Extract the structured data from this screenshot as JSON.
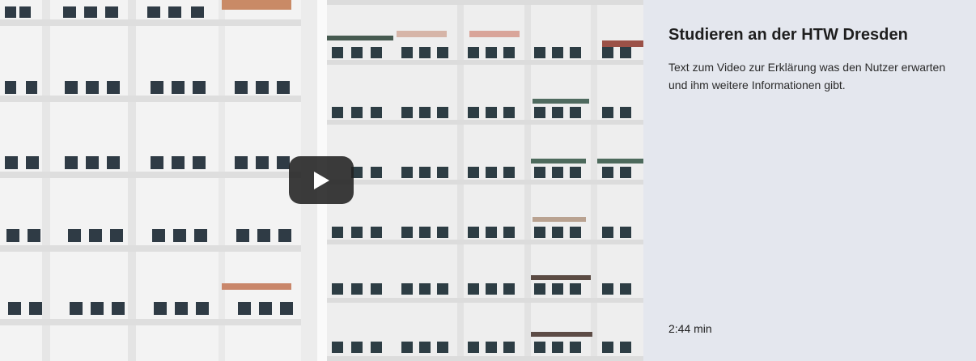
{
  "video": {
    "thumbnail_icon": "apartment-building-facade-image",
    "play_icon": "play-icon",
    "play_button_color": "#212121"
  },
  "info": {
    "title": "Studieren an der HTW Dresden",
    "description": "Text zum Video zur Erklärung was den Nutzer erwarten und ihm weitere Informationen gibt.",
    "duration": "2:44 min"
  },
  "colors": {
    "panel_background": "#e4e7ee",
    "title_color": "#1e1e1e"
  }
}
